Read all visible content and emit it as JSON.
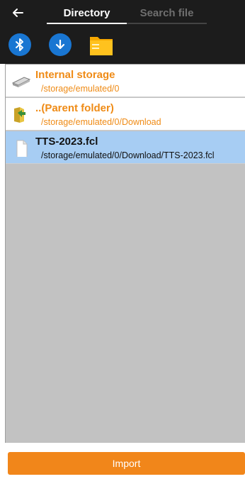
{
  "header": {
    "back_icon": "arrow-left-icon",
    "tabs": [
      {
        "label": "Directory",
        "active": true
      },
      {
        "label": "Search file",
        "active": false
      }
    ]
  },
  "toolbar": {
    "buttons": [
      {
        "icon": "bluetooth-icon"
      },
      {
        "icon": "download-icon"
      },
      {
        "icon": "folder-icon"
      }
    ]
  },
  "files": [
    {
      "icon": "drive-icon",
      "title": "Internal storage",
      "path": "/storage/emulated/0",
      "selected": false
    },
    {
      "icon": "folder-up-icon",
      "title": "..(Parent folder)",
      "path": "/storage/emulated/0/Download",
      "selected": false
    },
    {
      "icon": "file-icon",
      "title": "TTS-2023.fcl",
      "path": "/storage/emulated/0/Download/TTS-2023.fcl",
      "selected": true
    }
  ],
  "actions": {
    "import_label": "Import"
  },
  "colors": {
    "header_bg": "#1c1c1c",
    "accent_orange": "#ef8b16",
    "button_orange": "#f1861a",
    "selected_row": "#a7cdf3",
    "icon_blue": "#1976d2",
    "list_bg": "#c2c2c2"
  }
}
